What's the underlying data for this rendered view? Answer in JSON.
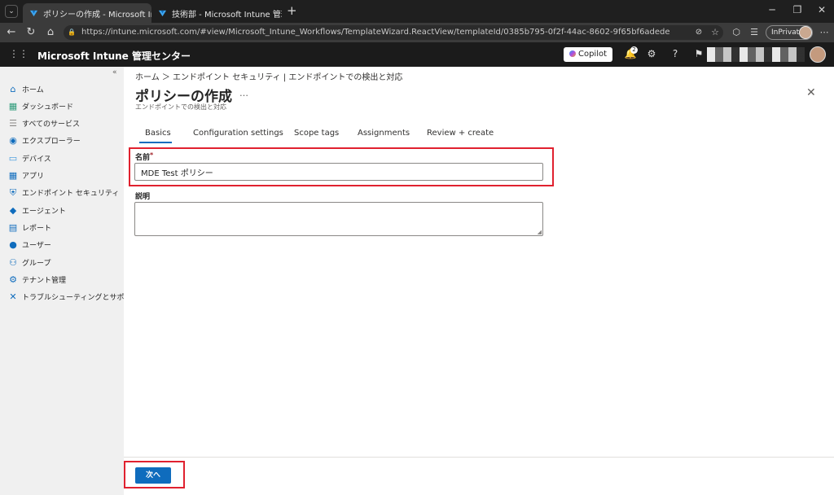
{
  "browser": {
    "tabs": [
      {
        "title": "ポリシーの作成 - Microsoft Intune 管"
      },
      {
        "title": "技術部 - Microsoft Intune 管理セン"
      }
    ],
    "new_tab_label": "+",
    "url": "https://intune.microsoft.com/#view/Microsoft_Intune_Workflows/TemplateWizard.ReactView/templateId/0385b795-0f2f-44ac-8602-9f65bf6adede",
    "inprivate_label": "InPrivate"
  },
  "app": {
    "name": "Microsoft Intune 管理センター",
    "copilot_label": "Copilot",
    "notification_count": "2"
  },
  "sidebar": {
    "collapse_label": "«",
    "items": [
      {
        "label": "ホーム",
        "icon": "home-icon",
        "color": "#0f6cbd"
      },
      {
        "label": "ダッシュボード",
        "icon": "dashboard-icon",
        "color": "#2e9b7a"
      },
      {
        "label": "すべてのサービス",
        "icon": "all-services-icon",
        "color": "#8a8886"
      },
      {
        "label": "エクスプローラー",
        "icon": "explorer-icon",
        "color": "#0f6cbd"
      },
      {
        "label": "デバイス",
        "icon": "devices-icon",
        "color": "#3a96dd"
      },
      {
        "label": "アプリ",
        "icon": "apps-icon",
        "color": "#0f6cbd"
      },
      {
        "label": "エンドポイント セキュリティ",
        "icon": "endpoint-security-icon",
        "color": "#0f6cbd"
      },
      {
        "label": "エージェント",
        "icon": "agents-icon",
        "color": "#0f6cbd"
      },
      {
        "label": "レポート",
        "icon": "reports-icon",
        "color": "#0f6cbd"
      },
      {
        "label": "ユーザー",
        "icon": "users-icon",
        "color": "#0f6cbd"
      },
      {
        "label": "グループ",
        "icon": "groups-icon",
        "color": "#0f6cbd"
      },
      {
        "label": "テナント管理",
        "icon": "tenant-admin-icon",
        "color": "#0f6cbd"
      },
      {
        "label": "トラブルシューティングとサポート",
        "icon": "troubleshooting-icon",
        "color": "#0f6cbd"
      }
    ]
  },
  "main": {
    "breadcrumb": "ホーム ＞ エンドポイント セキュリティ | エンドポイントでの検出と対応",
    "title": "ポリシーの作成",
    "ellipsis": "…",
    "subtitle": "エンドポイントでの検出と対応",
    "tabs": [
      {
        "label": "Basics",
        "selected": true
      },
      {
        "label": "Configuration settings"
      },
      {
        "label": "Scope tags"
      },
      {
        "label": "Assignments"
      },
      {
        "label": "Review + create"
      }
    ],
    "form": {
      "name_label": "名前",
      "required_mark": "*",
      "name_value": "MDE Test ポリシー",
      "description_label": "説明",
      "description_value": ""
    },
    "next_button": "次へ"
  },
  "colors": {
    "accent": "#0f6cbd",
    "highlight": "#e0212f"
  }
}
